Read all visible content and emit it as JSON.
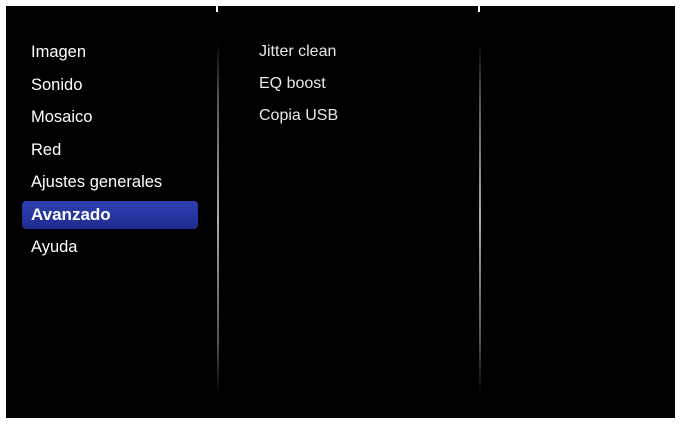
{
  "main_menu": {
    "items": [
      {
        "label": "Imagen"
      },
      {
        "label": "Sonido"
      },
      {
        "label": "Mosaico"
      },
      {
        "label": "Red"
      },
      {
        "label": "Ajustes generales"
      },
      {
        "label": "Avanzado",
        "selected": true
      },
      {
        "label": "Ayuda"
      }
    ],
    "selected_color": "#2a38a8"
  },
  "sub_menu": {
    "items": [
      {
        "label": "Jitter clean"
      },
      {
        "label": "EQ boost"
      },
      {
        "label": "Copia USB"
      }
    ]
  },
  "colors": {
    "background": "#000000",
    "text": "#ffffff"
  }
}
